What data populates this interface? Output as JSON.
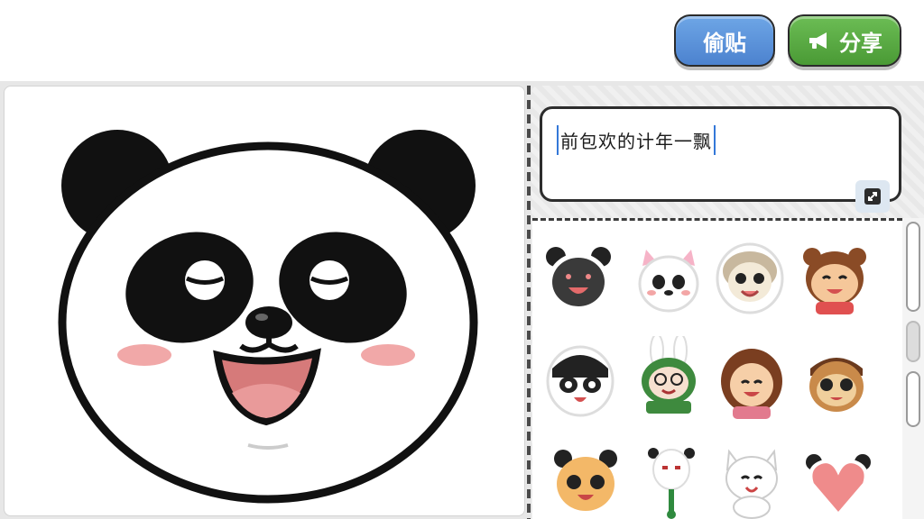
{
  "toolbar": {
    "copy_label": "偷贴",
    "share_label": "分享"
  },
  "editor": {
    "text_value": "前包欢的计年一飘"
  },
  "colors": {
    "blue_button": "#5a91d9",
    "green_button": "#58a942",
    "text_caret": "#3478d8"
  },
  "icons": {
    "share": "megaphone-icon",
    "resize": "resize-icon"
  },
  "stickers": [
    {
      "name": "black-bear"
    },
    {
      "name": "pink-eared-panda"
    },
    {
      "name": "sheep-panda"
    },
    {
      "name": "brown-girl-bear"
    },
    {
      "name": "panda-hoodie"
    },
    {
      "name": "green-bunny"
    },
    {
      "name": "brown-hair-girl"
    },
    {
      "name": "hat-bear"
    },
    {
      "name": "orange-panda"
    },
    {
      "name": "panda-lollipop"
    },
    {
      "name": "white-cat"
    },
    {
      "name": "pink-heart"
    }
  ]
}
